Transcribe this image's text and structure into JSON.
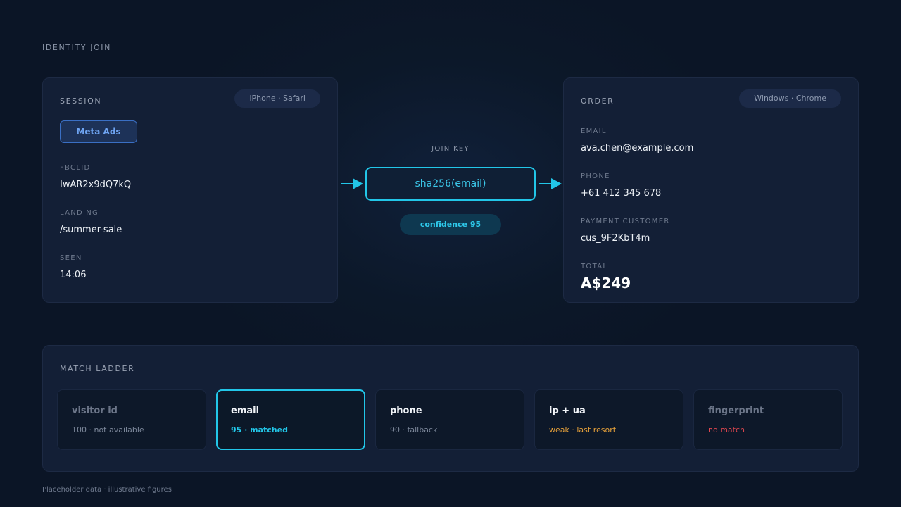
{
  "header": {
    "title": "IDENTITY JOIN"
  },
  "session": {
    "title": "SESSION",
    "device": "iPhone · Safari",
    "source": "Meta Ads",
    "fields": [
      {
        "label": "FBCLID",
        "value": "IwAR2x9dQ7kQ"
      },
      {
        "label": "LANDING",
        "value": "/summer-sale"
      },
      {
        "label": "SEEN",
        "value": "14:06"
      }
    ]
  },
  "join": {
    "label": "JOIN KEY",
    "key": "sha256(email)",
    "confidence": "confidence 95"
  },
  "order": {
    "title": "ORDER",
    "device": "Windows · Chrome",
    "fields": [
      {
        "label": "EMAIL",
        "value": "ava.chen@example.com"
      },
      {
        "label": "PHONE",
        "value": "+61 412 345 678"
      },
      {
        "label": "PAYMENT CUSTOMER",
        "value": "cus_9F2KbT4m"
      },
      {
        "label": "TOTAL",
        "value": "A$249"
      }
    ]
  },
  "ladder": {
    "title": "MATCH LADDER",
    "steps": [
      {
        "name": "visitor id",
        "status": "100 · not available",
        "status_color": "#7d889b",
        "name_color": "#6c7689"
      },
      {
        "name": "email",
        "status": "95 · matched",
        "status_color": "#22c6e8",
        "name_color": "#f2f5f9"
      },
      {
        "name": "phone",
        "status": "90 · fallback",
        "status_color": "#7d889b",
        "name_color": "#f2f5f9"
      },
      {
        "name": "ip + ua",
        "status": "weak · last resort",
        "status_color": "#e8a23a",
        "name_color": "#f2f5f9"
      },
      {
        "name": "fingerprint",
        "status": "no match",
        "status_color": "#e0474f",
        "name_color": "#6c7689"
      }
    ]
  },
  "footer": {
    "note": "Placeholder data · illustrative figures"
  },
  "colors": {
    "accent": "#22c6e8",
    "warning": "#e8a23a",
    "error": "#e0474f",
    "source_blue": "#6ea4f2"
  }
}
